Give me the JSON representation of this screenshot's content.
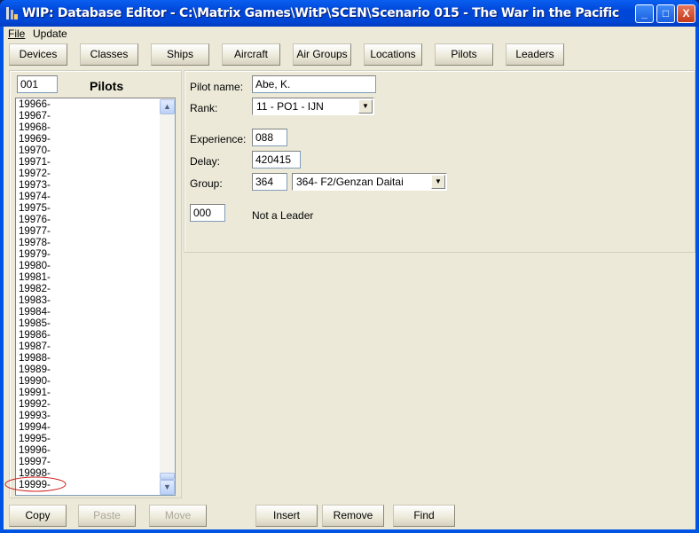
{
  "window": {
    "title": "WIP: Database Editor - C:\\Matrix Games\\WitP\\SCEN\\Scenario 015 - The War in the Pacific",
    "minimize": "_",
    "maximize": "□",
    "close": "X"
  },
  "menu": [
    {
      "label": "File"
    },
    {
      "label": "Update"
    }
  ],
  "tabs": [
    {
      "label": "Devices"
    },
    {
      "label": "Classes"
    },
    {
      "label": "Ships"
    },
    {
      "label": "Aircraft"
    },
    {
      "label": "Air Groups"
    },
    {
      "label": "Locations"
    },
    {
      "label": "Pilots"
    },
    {
      "label": "Leaders"
    }
  ],
  "left": {
    "index_value": "001",
    "heading": "Pilots",
    "items": [
      "19966-",
      "19967-",
      "19968-",
      "19969-",
      "19970-",
      "19971-",
      "19972-",
      "19973-",
      "19974-",
      "19975-",
      "19976-",
      "19977-",
      "19978-",
      "19979-",
      "19980-",
      "19981-",
      "19982-",
      "19983-",
      "19984-",
      "19985-",
      "19986-",
      "19987-",
      "19988-",
      "19989-",
      "19990-",
      "19991-",
      "19992-",
      "19993-",
      "19994-",
      "19995-",
      "19996-",
      "19997-",
      "19998-",
      "19999-"
    ],
    "highlighted_item": "19999-",
    "highlight_color": "#d02020"
  },
  "form": {
    "pilot_name_label": "Pilot name:",
    "pilot_name": "Abe, K.",
    "rank_label": "Rank:",
    "rank": "11 - PO1 - IJN",
    "experience_label": "Experience:",
    "experience": "088",
    "delay_label": "Delay:",
    "delay": "420415",
    "group_label": "Group:",
    "group_id": "364",
    "group": "364- F2/Genzan Daitai",
    "leader_id": "000",
    "leader_text": "Not a Leader"
  },
  "actions": [
    {
      "label": "Copy",
      "enabled": true
    },
    {
      "label": "Paste",
      "enabled": false
    },
    {
      "label": "Move",
      "enabled": false
    },
    {
      "label": "Insert",
      "enabled": true
    },
    {
      "label": "Remove",
      "enabled": true
    },
    {
      "label": "Find",
      "enabled": true
    }
  ]
}
